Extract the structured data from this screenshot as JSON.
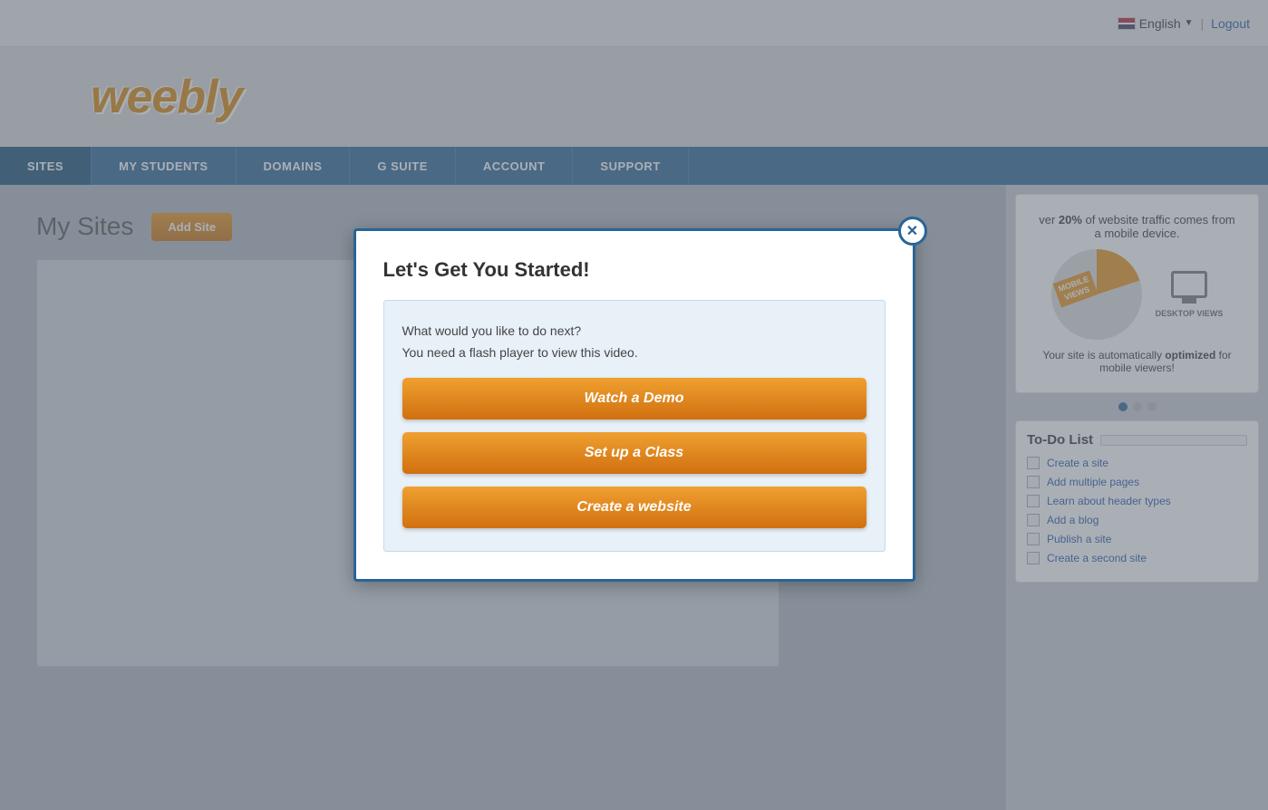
{
  "topbar": {
    "language": "English",
    "logout": "Logout",
    "separator": "|"
  },
  "logo": {
    "text": "weebly"
  },
  "nav": {
    "items": [
      {
        "label": "SITES",
        "active": true
      },
      {
        "label": "MY STUDENTS",
        "active": false
      },
      {
        "label": "DOMAINS",
        "active": false
      },
      {
        "label": "G SUITE",
        "active": false
      },
      {
        "label": "ACCOUNT",
        "active": false
      },
      {
        "label": "SUPPORT",
        "active": false
      }
    ]
  },
  "page": {
    "title": "My Sites",
    "add_site_label": "Add Site"
  },
  "promo": {
    "stat_text": "ver ",
    "stat_bold": "20%",
    "stat_suffix": " of website traffic comes from a mobile device.",
    "mobile_label": "MOBILE\nVIEWS",
    "desktop_label": "DESKTOP\nVIEWS",
    "bottom_text": "Your site is automatically ",
    "bottom_bold": "optimized",
    "bottom_suffix": " for mobile viewers!"
  },
  "todo": {
    "title": "To-Do List",
    "items": [
      {
        "label": "Create a site"
      },
      {
        "label": "Add multiple pages"
      },
      {
        "label": "Learn about header types"
      },
      {
        "label": "Add a blog"
      },
      {
        "label": "Publish a site"
      },
      {
        "label": "Create a second site"
      }
    ]
  },
  "modal": {
    "title": "Let's Get You Started!",
    "subtitle": "What would you like to do next?",
    "flash_note": "You need a flash player to view this video.",
    "btn_watch": "Watch a Demo",
    "btn_setup": "Set up a Class",
    "btn_create": "Create a website",
    "close_icon": "✕"
  }
}
